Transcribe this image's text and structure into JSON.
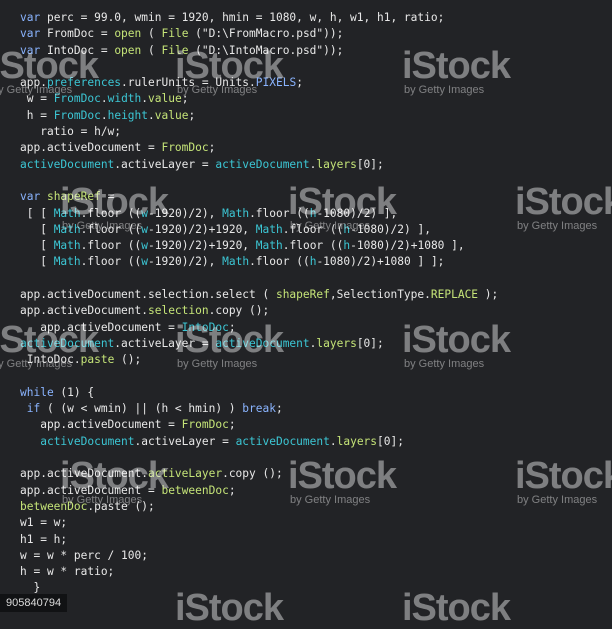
{
  "code": {
    "lines": [
      [
        {
          "t": "var ",
          "c": "k"
        },
        {
          "t": "perc = 99.0, wmin = 1920, hmin = 1080, w, h, w1, h1, ratio;",
          "c": "s"
        }
      ],
      [
        {
          "t": "var ",
          "c": "k"
        },
        {
          "t": "FromDoc = ",
          "c": "s"
        },
        {
          "t": "open",
          "c": "n"
        },
        {
          "t": " ( ",
          "c": "s"
        },
        {
          "t": "File",
          "c": "n"
        },
        {
          "t": " (\"D:\\FromMacro.psd\"));",
          "c": "s"
        }
      ],
      [
        {
          "t": "var ",
          "c": "k"
        },
        {
          "t": "IntoDoc = ",
          "c": "s"
        },
        {
          "t": "open",
          "c": "n"
        },
        {
          "t": " ( ",
          "c": "s"
        },
        {
          "t": "File",
          "c": "n"
        },
        {
          "t": " (\"D:\\IntoMacro.psd\"));",
          "c": "s"
        }
      ],
      [],
      [
        {
          "t": "app.",
          "c": "s"
        },
        {
          "t": "preferences",
          "c": "f"
        },
        {
          "t": ".rulerUnits = Units.",
          "c": "s"
        },
        {
          "t": "PIXELS",
          "c": "k"
        },
        {
          "t": ";",
          "c": "s"
        }
      ],
      [
        {
          "t": " w = ",
          "c": "s"
        },
        {
          "t": "FromDoc",
          "c": "f"
        },
        {
          "t": ".",
          "c": "s"
        },
        {
          "t": "width",
          "c": "f"
        },
        {
          "t": ".",
          "c": "s"
        },
        {
          "t": "value",
          "c": "n"
        },
        {
          "t": ";",
          "c": "s"
        }
      ],
      [
        {
          "t": " h = ",
          "c": "s"
        },
        {
          "t": "FromDoc",
          "c": "f"
        },
        {
          "t": ".",
          "c": "s"
        },
        {
          "t": "height",
          "c": "f"
        },
        {
          "t": ".",
          "c": "s"
        },
        {
          "t": "value",
          "c": "n"
        },
        {
          "t": ";",
          "c": "s"
        }
      ],
      [
        {
          "t": "   ratio = h/w;",
          "c": "s"
        }
      ],
      [
        {
          "t": "app.activeDocument = ",
          "c": "s"
        },
        {
          "t": "FromDoc",
          "c": "n"
        },
        {
          "t": ";",
          "c": "s"
        }
      ],
      [
        {
          "t": "activeDocument",
          "c": "f"
        },
        {
          "t": ".activeLayer = ",
          "c": "s"
        },
        {
          "t": "activeDocument",
          "c": "f"
        },
        {
          "t": ".",
          "c": "s"
        },
        {
          "t": "layers",
          "c": "n"
        },
        {
          "t": "[0];",
          "c": "s"
        }
      ],
      [],
      [
        {
          "t": "var ",
          "c": "k"
        },
        {
          "t": "shapeRef",
          "c": "n"
        },
        {
          "t": " =",
          "c": "s"
        }
      ],
      [
        {
          "t": " [ [ ",
          "c": "s"
        },
        {
          "t": "Math",
          "c": "f"
        },
        {
          "t": ".floor ((",
          "c": "s"
        },
        {
          "t": "w",
          "c": "f"
        },
        {
          "t": "-1920)/2), ",
          "c": "s"
        },
        {
          "t": "Math",
          "c": "f"
        },
        {
          "t": ".floor ((",
          "c": "s"
        },
        {
          "t": "h",
          "c": "f"
        },
        {
          "t": "-1080)/2) ],",
          "c": "s"
        }
      ],
      [
        {
          "t": "   [ ",
          "c": "s"
        },
        {
          "t": "Math",
          "c": "f"
        },
        {
          "t": ".floor ((",
          "c": "s"
        },
        {
          "t": "w",
          "c": "f"
        },
        {
          "t": "-1920)/2)+1920, ",
          "c": "s"
        },
        {
          "t": "Math",
          "c": "f"
        },
        {
          "t": ".floor ((",
          "c": "s"
        },
        {
          "t": "h",
          "c": "f"
        },
        {
          "t": "-1080)/2) ],",
          "c": "s"
        }
      ],
      [
        {
          "t": "   [ ",
          "c": "s"
        },
        {
          "t": "Math",
          "c": "f"
        },
        {
          "t": ".floor ((",
          "c": "s"
        },
        {
          "t": "w",
          "c": "f"
        },
        {
          "t": "-1920)/2)+1920, ",
          "c": "s"
        },
        {
          "t": "Math",
          "c": "f"
        },
        {
          "t": ".floor ((",
          "c": "s"
        },
        {
          "t": "h",
          "c": "f"
        },
        {
          "t": "-1080)/2)+1080 ],",
          "c": "s"
        }
      ],
      [
        {
          "t": "   [ ",
          "c": "s"
        },
        {
          "t": "Math",
          "c": "f"
        },
        {
          "t": ".floor ((",
          "c": "s"
        },
        {
          "t": "w",
          "c": "f"
        },
        {
          "t": "-1920)/2), ",
          "c": "s"
        },
        {
          "t": "Math",
          "c": "f"
        },
        {
          "t": ".floor ((",
          "c": "s"
        },
        {
          "t": "h",
          "c": "f"
        },
        {
          "t": "-1080)/2)+1080 ] ];",
          "c": "s"
        }
      ],
      [],
      [
        {
          "t": "app.activeDocument.selection.select ( ",
          "c": "s"
        },
        {
          "t": "shapeRef",
          "c": "n"
        },
        {
          "t": ",SelectionType.",
          "c": "s"
        },
        {
          "t": "REPLACE",
          "c": "n"
        },
        {
          "t": " );",
          "c": "s"
        }
      ],
      [
        {
          "t": "app.activeDocument.",
          "c": "s"
        },
        {
          "t": "selection",
          "c": "n"
        },
        {
          "t": ".copy ();",
          "c": "s"
        }
      ],
      [
        {
          "t": "   app.activeDocument = ",
          "c": "s"
        },
        {
          "t": "IntoDoc",
          "c": "f"
        },
        {
          "t": ";",
          "c": "s"
        }
      ],
      [
        {
          "t": "activeDocument",
          "c": "f"
        },
        {
          "t": ".activeLayer = ",
          "c": "s"
        },
        {
          "t": "activeDocument",
          "c": "f"
        },
        {
          "t": ".",
          "c": "s"
        },
        {
          "t": "layers",
          "c": "n"
        },
        {
          "t": "[0];",
          "c": "s"
        }
      ],
      [
        {
          "t": " IntoDoc.",
          "c": "s"
        },
        {
          "t": "paste",
          "c": "n"
        },
        {
          "t": " ();",
          "c": "s"
        }
      ],
      [],
      [
        {
          "t": "while",
          "c": "k"
        },
        {
          "t": " (1) {",
          "c": "s"
        }
      ],
      [
        {
          "t": " if",
          "c": "k"
        },
        {
          "t": " ( (w < wmin) || (h < hmin) ) ",
          "c": "s"
        },
        {
          "t": "break",
          "c": "k"
        },
        {
          "t": ";",
          "c": "s"
        }
      ],
      [
        {
          "t": "   app.activeDocument = ",
          "c": "s"
        },
        {
          "t": "FromDoc",
          "c": "n"
        },
        {
          "t": ";",
          "c": "s"
        }
      ],
      [
        {
          "t": "   ",
          "c": "s"
        },
        {
          "t": "activeDocument",
          "c": "f"
        },
        {
          "t": ".activeLayer = ",
          "c": "s"
        },
        {
          "t": "activeDocument",
          "c": "f"
        },
        {
          "t": ".",
          "c": "s"
        },
        {
          "t": "layers",
          "c": "n"
        },
        {
          "t": "[0];",
          "c": "s"
        }
      ],
      [],
      [
        {
          "t": "app.activeDocument.",
          "c": "s"
        },
        {
          "t": "activeLayer",
          "c": "n"
        },
        {
          "t": ".copy ();",
          "c": "s"
        }
      ],
      [
        {
          "t": "app.activeDocument = ",
          "c": "s"
        },
        {
          "t": "betweenDoc",
          "c": "n"
        },
        {
          "t": ";",
          "c": "s"
        }
      ],
      [
        {
          "t": "betweenDoc",
          "c": "n"
        },
        {
          "t": ".paste ();",
          "c": "s"
        }
      ],
      [
        {
          "t": "w1 = w;",
          "c": "s"
        }
      ],
      [
        {
          "t": "h1 = h;",
          "c": "s"
        }
      ],
      [
        {
          "t": "w = w * perc / 100;",
          "c": "s"
        }
      ],
      [
        {
          "t": "h = w * ratio;",
          "c": "s"
        }
      ],
      [
        {
          "t": "  }",
          "c": "s"
        }
      ]
    ]
  },
  "watermark": {
    "brand": "iStock",
    "credit": "by Getty Images"
  },
  "image_id": "905840794"
}
